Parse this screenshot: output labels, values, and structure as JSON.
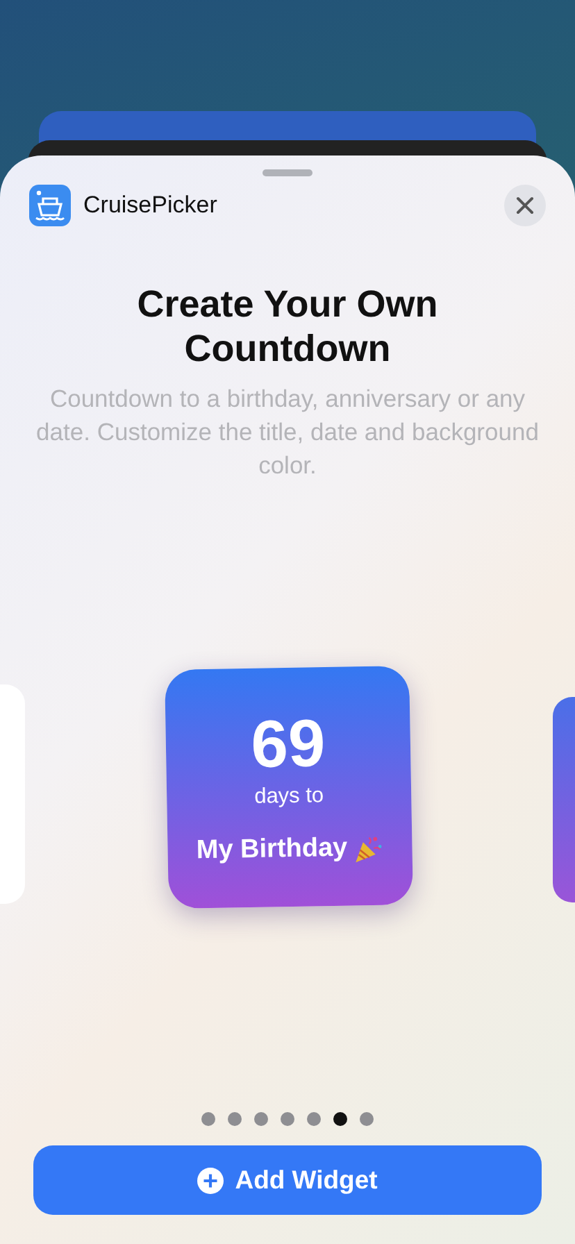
{
  "app": {
    "name": "CruisePicker"
  },
  "title": "Create Your Own Countdown",
  "description": "Countdown to a birthday, anniversary or any date. Customize the title, date and background color.",
  "widget": {
    "number": "69",
    "caption": "days to",
    "event": "My Birthday"
  },
  "pages": [
    {
      "selected": false
    },
    {
      "selected": false
    },
    {
      "selected": false
    },
    {
      "selected": false
    },
    {
      "selected": false
    },
    {
      "selected": true
    },
    {
      "selected": false
    }
  ],
  "button": {
    "label": "Add Widget"
  }
}
